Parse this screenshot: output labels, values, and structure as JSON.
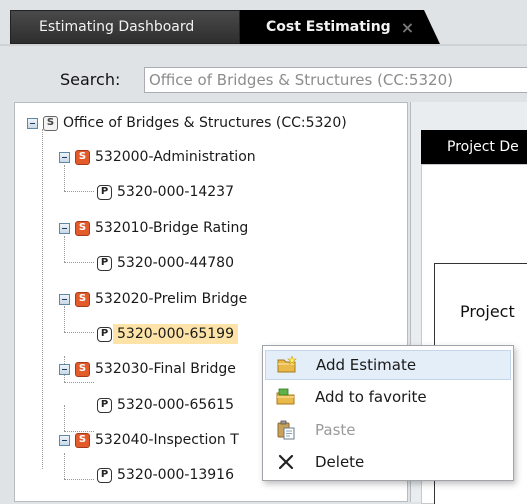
{
  "tabs": [
    {
      "label": "Estimating Dashboard"
    },
    {
      "label": "Cost Estimating",
      "close": "×"
    }
  ],
  "search": {
    "label": "Search:",
    "placeholder": "Office of Bridges & Structures (CC:5320)"
  },
  "tree": {
    "root": {
      "badge": "S",
      "label": "Office of Bridges & Structures (CC:5320)"
    },
    "groups": [
      {
        "badge": "S",
        "label": "532000-Administration",
        "project": {
          "badge": "P",
          "label": "5320-000-14237"
        }
      },
      {
        "badge": "S",
        "label": "532010-Bridge Rating",
        "project": {
          "badge": "P",
          "label": "5320-000-44780"
        }
      },
      {
        "badge": "S",
        "label": "532020-Prelim Bridge",
        "project": {
          "badge": "P",
          "label": "5320-000-65199"
        }
      },
      {
        "badge": "S",
        "label": "532030-Final Bridge",
        "project": {
          "badge": "P",
          "label": "5320-000-65615"
        }
      },
      {
        "badge": "S",
        "label": "532040-Inspection T",
        "project": {
          "badge": "P",
          "label": "5320-000-13916"
        }
      }
    ]
  },
  "right_panel": {
    "tab_label": "Project De",
    "body_label": "Project"
  },
  "context_menu": {
    "items": [
      {
        "label": "Add Estimate",
        "icon": "folder-new-icon"
      },
      {
        "label": "Add to favorite",
        "icon": "folder-add-icon"
      },
      {
        "label": "Paste",
        "icon": "paste-icon"
      },
      {
        "label": "Delete",
        "icon": "delete-icon"
      }
    ]
  },
  "colors": {
    "tab_active": "#000000",
    "badge_s": "#e35b2a",
    "selection": "#fde3a7",
    "menu_hover": "#e4eef8"
  }
}
